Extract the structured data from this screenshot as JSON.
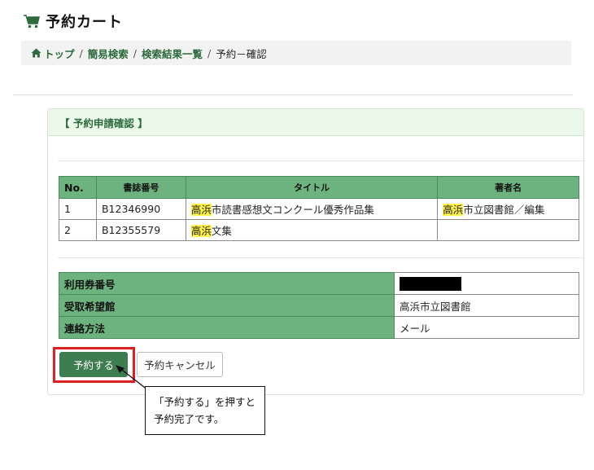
{
  "page": {
    "title": "予約カート",
    "cart_icon": "cart-icon",
    "accent_color": "#2c6b3d"
  },
  "breadcrumb": {
    "home_icon": "home-icon",
    "items": [
      "トップ",
      "簡易検索",
      "検索結果一覧"
    ],
    "current": "予約－確認",
    "separator": "/"
  },
  "panel": {
    "title": "【 予約申請確認 】"
  },
  "items_table": {
    "headers": [
      "No.",
      "書誌番号",
      "タイトル",
      "著者名"
    ],
    "rows": [
      {
        "no": "1",
        "id": "B12346990",
        "title_hl": "高浜",
        "title_rest": "市読書感想文コンクール優秀作品集",
        "author_hl": "高浜",
        "author_rest": "市立図書館／編集"
      },
      {
        "no": "2",
        "id": "B12355579",
        "title_hl": "高浜",
        "title_rest": "文集",
        "author_hl": "",
        "author_rest": ""
      }
    ]
  },
  "info_table": {
    "card_number_label": "利用券番号",
    "pickup_label": "受取希望館",
    "pickup_value": "高浜市立図書館",
    "contact_label": "連絡方法",
    "contact_value": "メール"
  },
  "buttons": {
    "reserve": "予約する",
    "cancel": "予約キャンセル"
  },
  "callout": {
    "line1": "「予約する」を押すと",
    "line2": "予約完了です。"
  }
}
